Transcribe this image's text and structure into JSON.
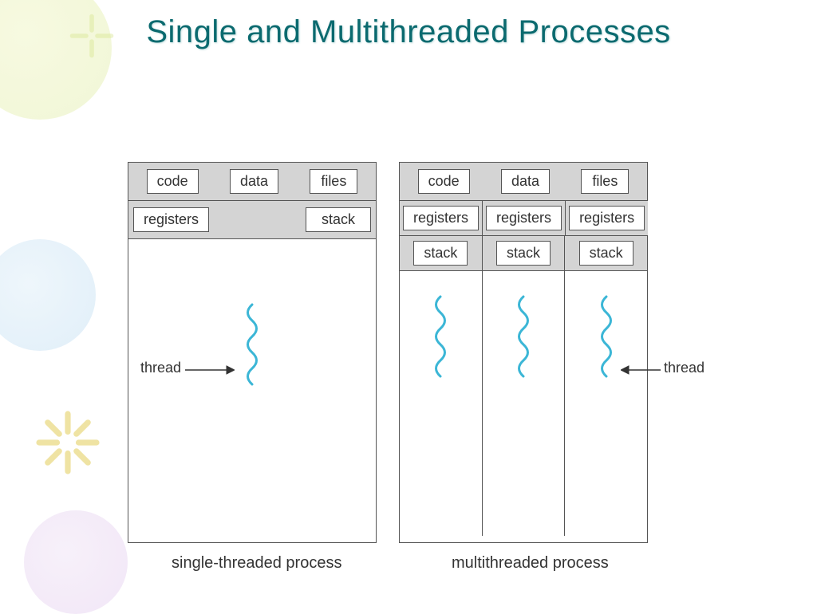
{
  "title": "Single and Multithreaded Processes",
  "shared": {
    "code": "code",
    "data": "data",
    "files": "files"
  },
  "per_thread": {
    "registers": "registers",
    "stack": "stack"
  },
  "labels": {
    "thread": "thread"
  },
  "captions": {
    "single": "single-threaded process",
    "multi": "multithreaded process"
  },
  "colors": {
    "accent": "#0b6a6f",
    "squiggle": "#3bb6d6"
  }
}
